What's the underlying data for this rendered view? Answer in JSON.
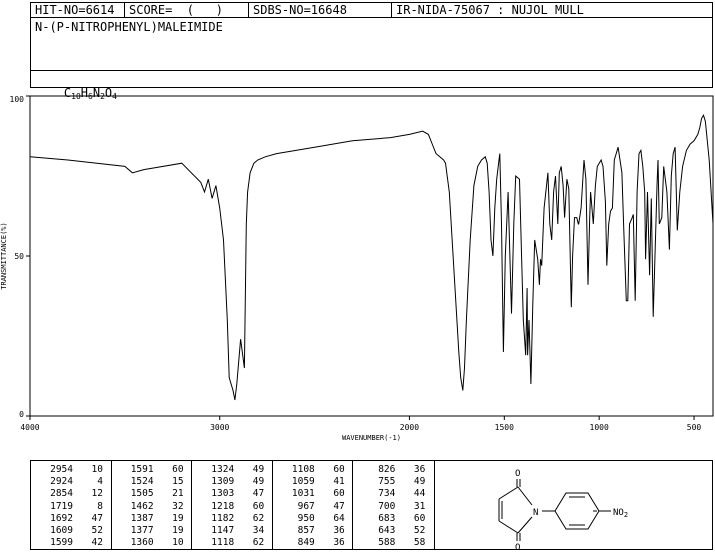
{
  "header": {
    "hit_no": "HIT-NO=6614",
    "score": "SCORE=  (   )",
    "sdbs_no": "SDBS-NO=16648",
    "ir_info": "IR-NIDA-75067 : NUJOL MULL"
  },
  "compound": {
    "name": "N-(P-NITROPHENYL)MALEIMIDE",
    "formula_parts": [
      "C",
      "10",
      "H",
      "6",
      "N",
      "2",
      "O",
      "4"
    ]
  },
  "chart_data": {
    "type": "line",
    "xlabel": "WAVENUMBER(-1)",
    "ylabel": "TRANSMITTANCE(%)",
    "xlim": [
      4000,
      400
    ],
    "ylim": [
      0,
      100
    ],
    "x_ticks": [
      4000,
      3000,
      2000,
      1500,
      1000,
      500
    ],
    "y_ticks": [
      0,
      50,
      100
    ],
    "series": [
      {
        "x": [
          4000,
          3800,
          3500,
          3460,
          3400,
          3200,
          3100,
          3080,
          3060,
          3040,
          3020,
          3000,
          2980,
          2960,
          2950,
          2930,
          2920,
          2910,
          2890,
          2870,
          2860,
          2853,
          2840,
          2820,
          2800,
          2760,
          2700,
          2500,
          2300,
          2100,
          2000,
          1930,
          1900,
          1880,
          1860,
          1840,
          1820,
          1810,
          1790,
          1780,
          1760,
          1740,
          1730,
          1719,
          1710,
          1700,
          1692,
          1680,
          1660,
          1640,
          1620,
          1600,
          1590,
          1580,
          1570,
          1560,
          1550,
          1540,
          1530,
          1524,
          1515,
          1505,
          1495,
          1480,
          1462,
          1450,
          1440,
          1420,
          1400,
          1387,
          1380,
          1377,
          1370,
          1360,
          1350,
          1340,
          1324,
          1315,
          1309,
          1303,
          1290,
          1270,
          1260,
          1250,
          1240,
          1230,
          1218,
          1210,
          1200,
          1190,
          1182,
          1170,
          1160,
          1147,
          1140,
          1130,
          1118,
          1110,
          1108,
          1095,
          1080,
          1070,
          1059,
          1050,
          1045,
          1031,
          1020,
          1010,
          1000,
          990,
          980,
          967,
          960,
          950,
          940,
          930,
          920,
          910,
          900,
          880,
          870,
          857,
          849,
          840,
          826,
          820,
          810,
          800,
          790,
          780,
          770,
          760,
          755,
          745,
          734,
          725,
          715,
          700,
          695,
          690,
          683,
          670,
          660,
          643,
          630,
          620,
          610,
          600,
          588,
          575,
          560,
          540,
          520,
          500,
          480,
          470,
          460,
          450,
          440,
          430,
          420,
          410,
          400
        ],
        "y": [
          81,
          80,
          78,
          76,
          77,
          79,
          73,
          70,
          74,
          68,
          72,
          65,
          55,
          30,
          12,
          8,
          5,
          10,
          24,
          15,
          60,
          70,
          76,
          79,
          80,
          81,
          82,
          84,
          86,
          87,
          88,
          89,
          88,
          85,
          82,
          81,
          80,
          79,
          70,
          60,
          40,
          20,
          12,
          8,
          15,
          30,
          40,
          55,
          72,
          78,
          80,
          81,
          79,
          70,
          55,
          50,
          65,
          74,
          79,
          82,
          60,
          20,
          50,
          70,
          32,
          60,
          75,
          74,
          30,
          19,
          40,
          19,
          30,
          10,
          35,
          55,
          49,
          41,
          49,
          47,
          65,
          76,
          60,
          55,
          70,
          75,
          60,
          76,
          78,
          72,
          62,
          74,
          71,
          34,
          50,
          62,
          62,
          60,
          60,
          65,
          80,
          74,
          41,
          62,
          70,
          60,
          72,
          78,
          79,
          80,
          78,
          67,
          47,
          60,
          64,
          65,
          80,
          82,
          84,
          76,
          58,
          36,
          36,
          60,
          62,
          63,
          36,
          70,
          82,
          83,
          78,
          70,
          49,
          70,
          44,
          68,
          31,
          62,
          72,
          80,
          60,
          62,
          78,
          70,
          52,
          75,
          82,
          84,
          58,
          70,
          78,
          83,
          85,
          86,
          88,
          90,
          93,
          94,
          92,
          86,
          80,
          70,
          60
        ]
      }
    ],
    "peaks": [
      {
        "wn": 2954,
        "t": 10
      },
      {
        "wn": 2924,
        "t": 4
      },
      {
        "wn": 2854,
        "t": 12
      },
      {
        "wn": 1719,
        "t": 8
      },
      {
        "wn": 1692,
        "t": 47
      },
      {
        "wn": 1609,
        "t": 52
      },
      {
        "wn": 1599,
        "t": 42
      },
      {
        "wn": 1591,
        "t": 60
      },
      {
        "wn": 1524,
        "t": 15
      },
      {
        "wn": 1505,
        "t": 21
      },
      {
        "wn": 1462,
        "t": 32
      },
      {
        "wn": 1387,
        "t": 19
      },
      {
        "wn": 1377,
        "t": 19
      },
      {
        "wn": 1360,
        "t": 10
      },
      {
        "wn": 1324,
        "t": 49
      },
      {
        "wn": 1309,
        "t": 49
      },
      {
        "wn": 1303,
        "t": 47
      },
      {
        "wn": 1218,
        "t": 60
      },
      {
        "wn": 1182,
        "t": 62
      },
      {
        "wn": 1147,
        "t": 34
      },
      {
        "wn": 1118,
        "t": 62
      },
      {
        "wn": 1108,
        "t": 60
      },
      {
        "wn": 1059,
        "t": 41
      },
      {
        "wn": 1031,
        "t": 60
      },
      {
        "wn": 967,
        "t": 47
      },
      {
        "wn": 950,
        "t": 64
      },
      {
        "wn": 857,
        "t": 36
      },
      {
        "wn": 849,
        "t": 36
      },
      {
        "wn": 826,
        "t": 36
      },
      {
        "wn": 755,
        "t": 49
      },
      {
        "wn": 734,
        "t": 44
      },
      {
        "wn": 700,
        "t": 31
      },
      {
        "wn": 683,
        "t": 60
      },
      {
        "wn": 643,
        "t": 52
      },
      {
        "wn": 588,
        "t": 58
      }
    ]
  },
  "structure": {
    "o_top": "O",
    "o_bottom": "O",
    "n_label": "N",
    "no2_label": "NO",
    "no2_sub": "2"
  }
}
